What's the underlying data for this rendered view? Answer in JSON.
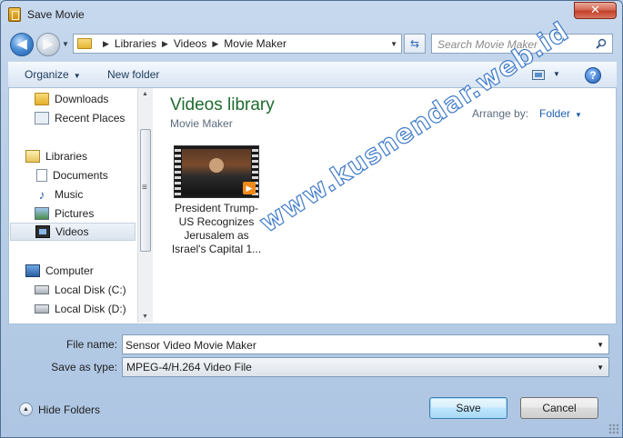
{
  "window": {
    "title": "Save Movie",
    "close_glyph": "✕"
  },
  "nav": {
    "back_glyph": "◀",
    "forward_glyph": "▶",
    "breadcrumbs": [
      "Libraries",
      "Videos",
      "Movie Maker"
    ],
    "refresh_glyph": "⇆",
    "search_placeholder": "Search Movie Maker"
  },
  "toolbar": {
    "organize_label": "Organize",
    "new_folder_label": "New folder",
    "help_glyph": "?"
  },
  "sidebar": {
    "items": [
      {
        "label": "Downloads",
        "icon": "folder-icon"
      },
      {
        "label": "Recent Places",
        "icon": "recent-places-icon"
      },
      {
        "label": "Libraries",
        "icon": "libraries-icon"
      },
      {
        "label": "Documents",
        "icon": "documents-icon"
      },
      {
        "label": "Music",
        "icon": "music-icon"
      },
      {
        "label": "Pictures",
        "icon": "pictures-icon"
      },
      {
        "label": "Videos",
        "icon": "videos-icon",
        "selected": true
      },
      {
        "label": "Computer",
        "icon": "computer-icon"
      },
      {
        "label": "Local Disk (C:)",
        "icon": "disk-icon"
      },
      {
        "label": "Local Disk (D:)",
        "icon": "disk-icon"
      }
    ]
  },
  "main": {
    "library_title": "Videos library",
    "library_subtitle": "Movie Maker",
    "arrange_label": "Arrange by:",
    "arrange_value": "Folder",
    "files": [
      {
        "name": "President Trump-US Recognizes Jerusalem as Israel's Capital 1..."
      }
    ]
  },
  "form": {
    "file_name_label": "File name:",
    "file_name_value": "Sensor Video Movie Maker",
    "save_type_label": "Save as type:",
    "save_type_value": "MPEG-4/H.264 Video File"
  },
  "footer": {
    "hide_folders_label": "Hide Folders",
    "save_label": "Save",
    "cancel_label": "Cancel"
  },
  "watermark": {
    "text": "www.kusnendar.web.id"
  },
  "colors": {
    "accent": "#1e6b2e",
    "link": "#1e5fb0",
    "chrome": "#bcd0e8"
  }
}
